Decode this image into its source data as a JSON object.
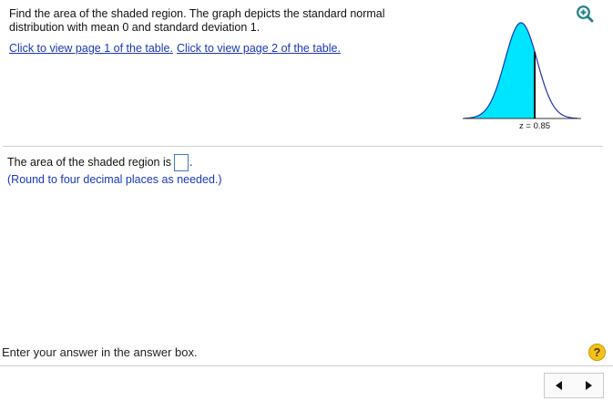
{
  "question": {
    "line1": "Find the area of the shaded region. The graph depicts the standard normal",
    "line2": "distribution with mean 0 and standard deviation 1.",
    "link1": "Click to view page 1 of the table.",
    "link2": "Click to view page 2 of the table."
  },
  "graph": {
    "z_label": "z = 0.85",
    "z_value": 0.85,
    "shaded": "left of z",
    "curve_color": "#1a33b8",
    "fill_color": "#00e5ff"
  },
  "answer": {
    "prompt": "The area of the shaded region is",
    "period": ".",
    "value": "",
    "instruction": "(Round to four decimal places as needed.)"
  },
  "footer": {
    "status": "Enter your answer in the answer box.",
    "help_symbol": "?"
  },
  "icons": {
    "zoom": "zoom-in-icon",
    "help": "help-icon",
    "prev": "arrow-left-icon",
    "next": "arrow-right-icon"
  }
}
